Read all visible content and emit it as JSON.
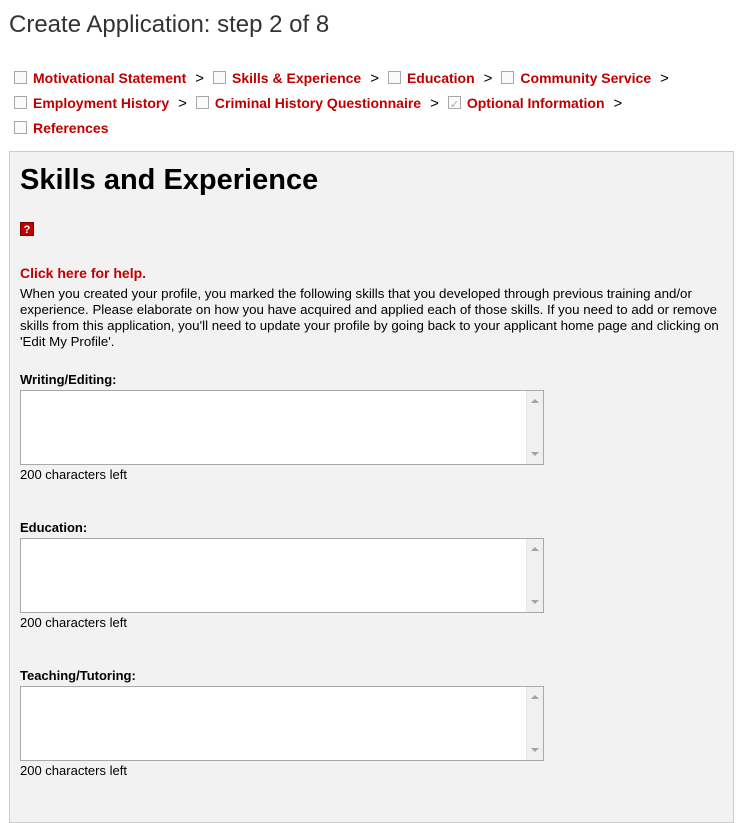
{
  "page": {
    "title": "Create Application: step 2 of 8"
  },
  "steps": [
    {
      "label": "Motivational Statement",
      "checked": false
    },
    {
      "label": "Skills & Experience",
      "checked": false
    },
    {
      "label": "Education",
      "checked": false
    },
    {
      "label": "Community Service",
      "checked": false
    },
    {
      "label": "Employment History",
      "checked": false
    },
    {
      "label": "Criminal History Questionnaire",
      "checked": false
    },
    {
      "label": "Optional Information",
      "checked": true
    },
    {
      "label": "References",
      "checked": false
    }
  ],
  "separator": ">",
  "section": {
    "heading": "Skills and Experience",
    "help_icon": "question-mark-icon",
    "help_link": "Click here for help.",
    "intro": "When you created your profile, you marked the following skills that you developed through previous training and/or experience. Please elaborate on how you have acquired and applied each of those skills. If you need to add or remove skills from this application, you'll need to update your profile by going back to your applicant home page and clicking on 'Edit My Profile'."
  },
  "fields": [
    {
      "label": "Writing/Editing:",
      "value": "",
      "chars_left": "200 characters left"
    },
    {
      "label": "Education:",
      "value": "",
      "chars_left": "200 characters left"
    },
    {
      "label": "Teaching/Tutoring:",
      "value": "",
      "chars_left": "200 characters left"
    }
  ],
  "colors": {
    "link": "#c00000",
    "panel_bg": "#f2f2f2",
    "title": "#333333"
  }
}
